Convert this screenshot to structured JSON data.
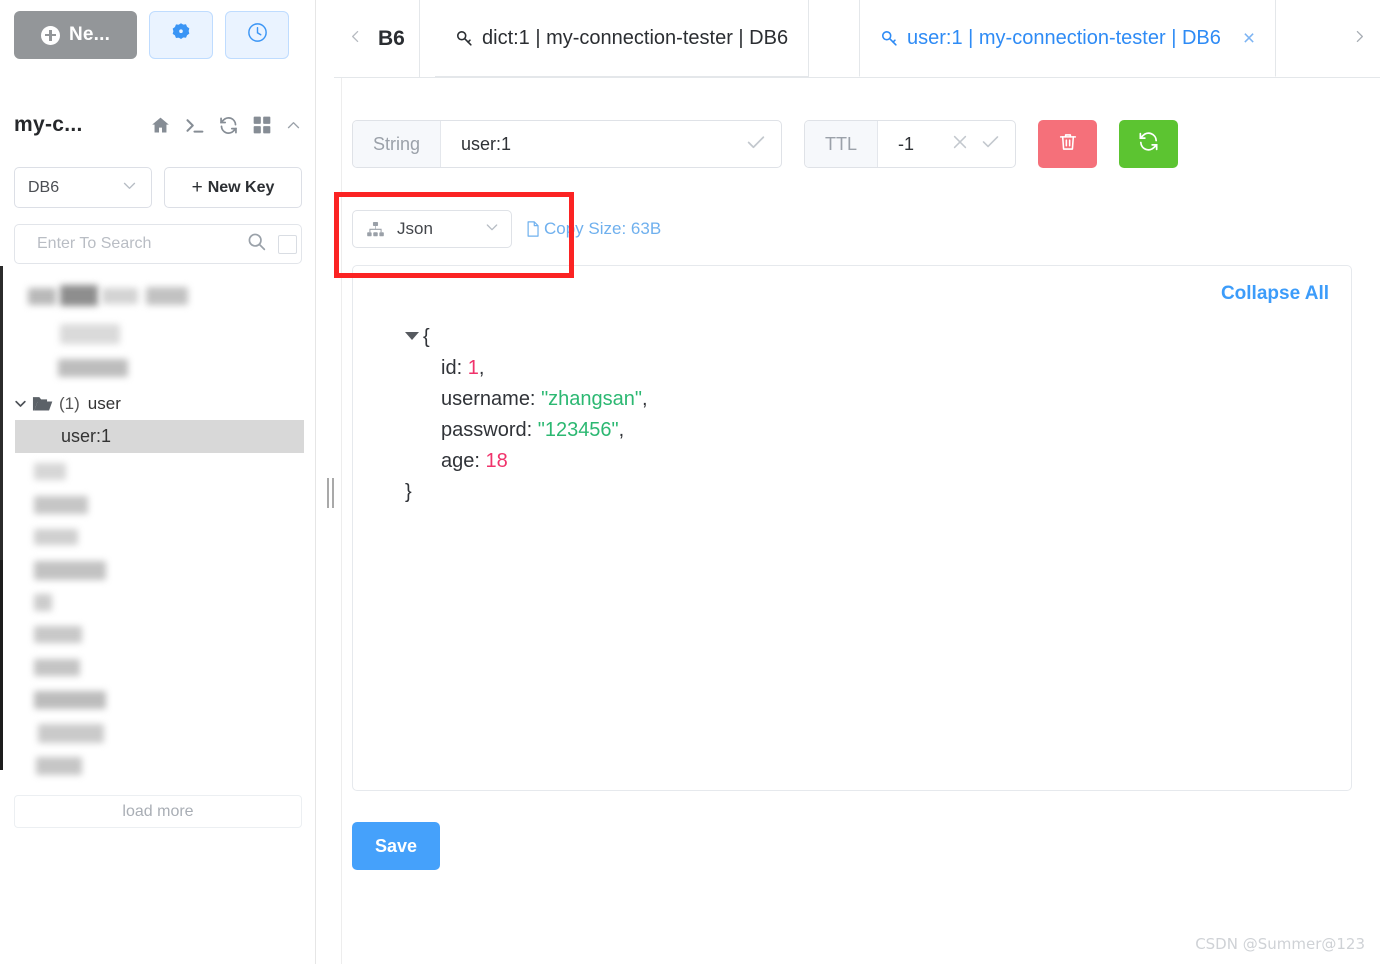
{
  "sidebar": {
    "new_button": {
      "label": "Ne...",
      "icon": "plus-circle-icon"
    },
    "icon_buttons": [
      {
        "name": "settings-gear-icon",
        "title": "settings"
      },
      {
        "name": "history-clock-icon",
        "title": "history"
      }
    ],
    "connection_name": "my-c...",
    "header_icons": [
      "home-icon",
      "terminal-icon",
      "refresh-icon",
      "grid-icon",
      "chevron-up-icon"
    ],
    "db_select": {
      "value": "DB6",
      "icon": "chevron-down-icon"
    },
    "new_key_button": {
      "label": "New Key",
      "icon": "plus-icon"
    },
    "search": {
      "placeholder": "Enter To Search",
      "value": "",
      "icon": "search-icon"
    },
    "tree": {
      "folder": {
        "caret": "chevron-down-icon",
        "icon": "folder-open-icon",
        "count": "(1)",
        "label": "user"
      },
      "selected_key": "user:1"
    },
    "load_more": "load more"
  },
  "tabbar": {
    "prev_arrow": "chevron-left-icon",
    "next_arrow": "chevron-right-icon",
    "stub_label": "B6",
    "tabs": [
      {
        "label": "dict:1 | my-connection-tester | DB6",
        "icon": "key-icon",
        "active": false
      },
      {
        "label": "user:1 | my-connection-tester | DB6",
        "icon": "key-icon",
        "active": true,
        "close": "×"
      }
    ]
  },
  "main": {
    "key_field": {
      "type_label": "String",
      "value": "user:1",
      "confirm_icon": "check-icon"
    },
    "ttl_field": {
      "label": "TTL",
      "value": "-1",
      "cancel_icon": "close-icon",
      "confirm_icon": "check-icon"
    },
    "delete_button": {
      "icon": "trash-icon",
      "color": "#f5707a"
    },
    "refresh_button": {
      "icon": "refresh-icon",
      "color": "#5cc431"
    },
    "format_select": {
      "value": "Json",
      "icon": "tree-structure-icon",
      "chevron": "chevron-down-icon"
    },
    "copy_link": {
      "label": "Copy Size: 63B",
      "icon": "document-icon",
      "color": "#6fb0ee"
    },
    "collapse_all": "Collapse All",
    "json_view": {
      "open_brace": "{",
      "close_brace": "}",
      "entries": [
        {
          "key": "id:",
          "value": "1",
          "kind": "number",
          "comma": ","
        },
        {
          "key": "username:",
          "value": "\"zhangsan\"",
          "kind": "string",
          "comma": ","
        },
        {
          "key": "password:",
          "value": "\"123456\"",
          "kind": "string",
          "comma": ","
        },
        {
          "key": "age:",
          "value": "18",
          "kind": "number",
          "comma": ""
        }
      ]
    },
    "save_button": "Save"
  },
  "annotation": {
    "highlight_color": "#fb2323"
  },
  "watermark": "CSDN @Summer@123"
}
